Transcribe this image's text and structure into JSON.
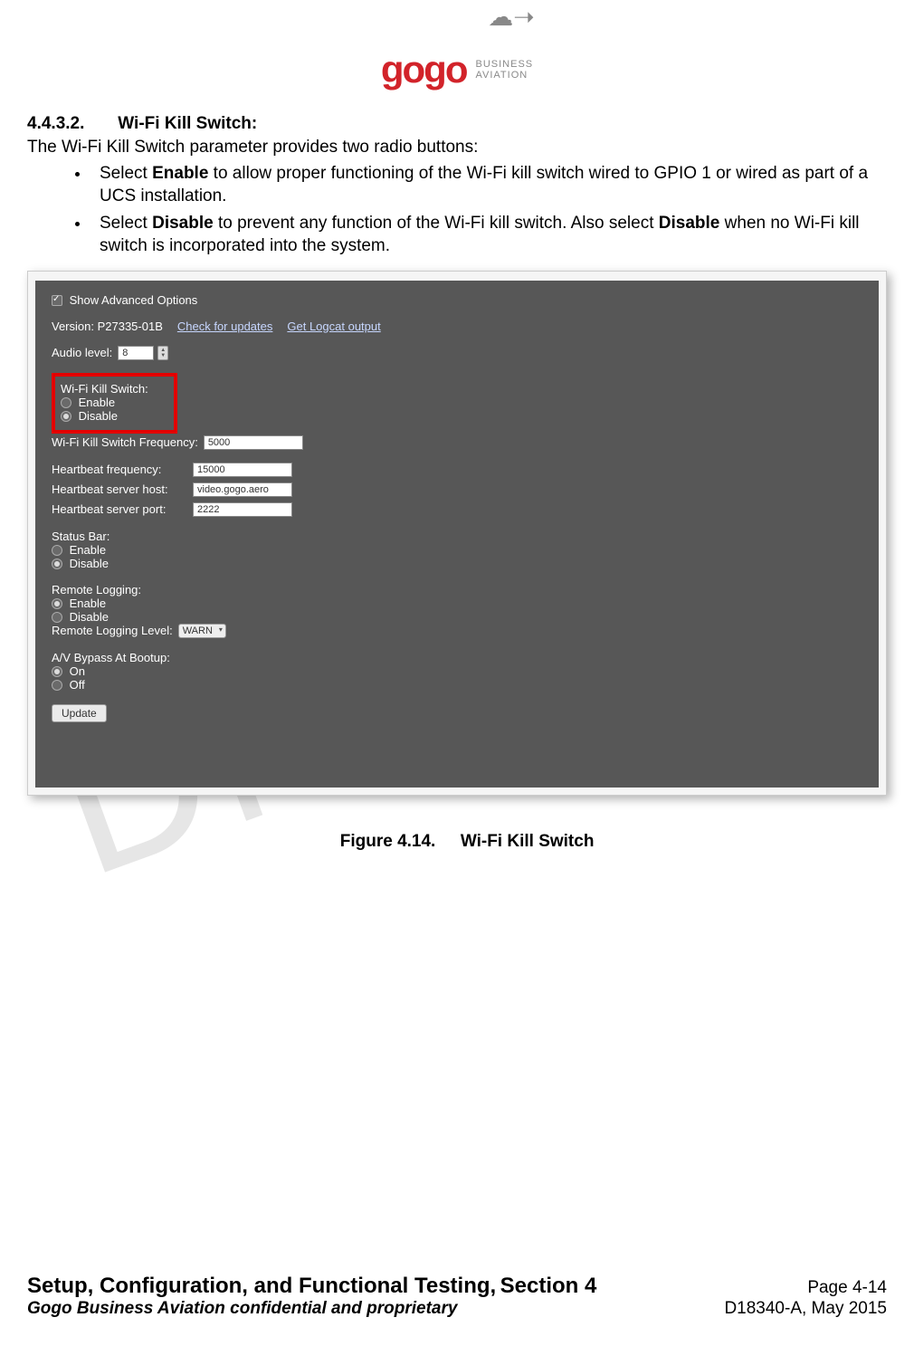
{
  "logo": {
    "brand": "gogo",
    "sub1": "BUSINESS",
    "sub2": "AVIATION"
  },
  "heading": {
    "number": "4.4.3.2.",
    "title": "Wi-Fi Kill Switch:"
  },
  "intro": "The Wi-Fi Kill Switch parameter provides two radio buttons:",
  "bullets": [
    {
      "pre": "Select ",
      "b1": "Enable",
      "post": " to allow proper functioning of the Wi-Fi kill switch wired to GPIO 1 or wired as part of a UCS installation."
    },
    {
      "pre": "Select ",
      "b1": "Disable",
      "mid": " to prevent any function of the Wi-Fi kill switch.  Also select ",
      "b2": "Disable",
      "post": " when no Wi-Fi kill switch is incorporated into the system."
    }
  ],
  "panel": {
    "show_advanced": "Show Advanced Options",
    "version_label": "Version: P27335-01B",
    "check_updates": "Check for updates",
    "get_logcat": "Get Logcat output",
    "audio_level_label": "Audio level:",
    "audio_level_value": "8",
    "wifi_kill_label": "Wi-Fi Kill Switch:",
    "enable": "Enable",
    "disable": "Disable",
    "wifi_freq_label": "Wi-Fi Kill Switch Frequency:",
    "wifi_freq_value": "5000",
    "hb_freq_label": "Heartbeat frequency:",
    "hb_freq_value": "15000",
    "hb_host_label": "Heartbeat server host:",
    "hb_host_value": "video.gogo.aero",
    "hb_port_label": "Heartbeat server port:",
    "hb_port_value": "2222",
    "status_bar_label": "Status Bar:",
    "remote_log_label": "Remote Logging:",
    "remote_log_level_label": "Remote Logging Level:",
    "remote_log_level_value": "WARN",
    "av_bypass_label": "A/V Bypass At Bootup:",
    "on": "On",
    "off": "Off",
    "update": "Update"
  },
  "figure": {
    "num": "Figure 4.14.",
    "title": "Wi-Fi Kill Switch"
  },
  "watermark": "Draft",
  "footer": {
    "title": "Setup, Configuration, and Functional Testing,",
    "section": " Section 4",
    "page": "Page 4-14",
    "conf": "Gogo Business Aviation confidential and proprietary",
    "doc": "D18340-A, May 2015"
  }
}
